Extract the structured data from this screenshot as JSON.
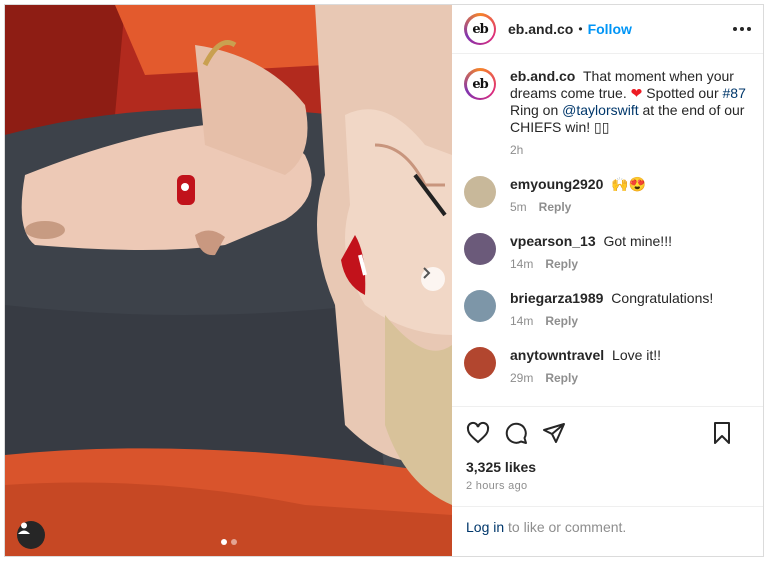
{
  "post": {
    "username": "eb.and.co",
    "follow_label": "Follow",
    "avatar_text": "eb",
    "caption": {
      "text_before": "That moment when your dreams come true.",
      "heart": "❤",
      "text_mid": "Spotted our",
      "hashtag": "#87",
      "text_mid2": "Ring on",
      "mention": "@taylorswift",
      "text_after": "at the end of our CHIEFS win! ▯▯",
      "time": "2h"
    },
    "comments": [
      {
        "user": "emyoung2920",
        "text": "🙌😍",
        "time": "5m",
        "reply": "Reply",
        "avatar_color": "#c8b89a"
      },
      {
        "user": "vpearson_13",
        "text": "Got mine!!!",
        "time": "14m",
        "reply": "Reply",
        "avatar_color": "#6b5a7a"
      },
      {
        "user": "briegarza1989",
        "text": "Congratulations!",
        "time": "14m",
        "reply": "Reply",
        "avatar_color": "#7d96a8"
      },
      {
        "user": "anytowntravel",
        "text": "Love it!!",
        "time": "29m",
        "reply": "Reply",
        "avatar_color": "#b2462f"
      }
    ],
    "likes": "3,325 likes",
    "posted_ago": "2 hours ago",
    "login_link": "Log in",
    "login_text": "to like or comment.",
    "carousel": {
      "current": 1,
      "total": 2
    }
  },
  "icons": {
    "like": "heart-icon",
    "comment": "comment-icon",
    "share": "paper-plane-icon",
    "save": "bookmark-icon",
    "more": "more-horizontal-icon",
    "next": "chevron-right-icon",
    "tag": "user-tag-icon"
  },
  "colors": {
    "accent": "#0095f6",
    "heart": "#ed1c24",
    "link": "#00376b"
  }
}
